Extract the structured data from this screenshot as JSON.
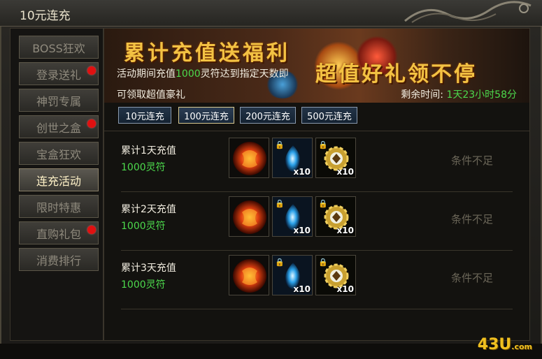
{
  "window": {
    "title": "10元连充"
  },
  "sidebar": {
    "items": [
      {
        "label": "BOSS狂欢",
        "badge": false,
        "active": false
      },
      {
        "label": "登录送礼",
        "badge": true,
        "active": false
      },
      {
        "label": "神罚专属",
        "badge": false,
        "active": false
      },
      {
        "label": "创世之盒",
        "badge": true,
        "active": false
      },
      {
        "label": "宝盒狂欢",
        "badge": false,
        "active": false
      },
      {
        "label": "连充活动",
        "badge": false,
        "active": true
      },
      {
        "label": "限时特惠",
        "badge": false,
        "active": false
      },
      {
        "label": "直购礼包",
        "badge": true,
        "active": false
      },
      {
        "label": "消费排行",
        "badge": false,
        "active": false
      }
    ]
  },
  "banner": {
    "title": "累计充值送福利",
    "slogan": "超值好礼领不停",
    "desc_prefix": "活动期间充值",
    "desc_highlight": "1000",
    "desc_suffix": "灵符达到指定天数即",
    "desc_line2": "可领取超值豪礼",
    "remain_label": "剩余时间:",
    "remain_value": "1天23小时58分"
  },
  "tabs": [
    {
      "label": "10元连充",
      "active": false
    },
    {
      "label": "100元连充",
      "active": true
    },
    {
      "label": "200元连充",
      "active": false
    },
    {
      "label": "500元连充",
      "active": false
    }
  ],
  "rows": [
    {
      "label": "累计1天充值",
      "amount": "1000灵符",
      "status": "条件不足",
      "items": [
        {
          "icon": "fire-orb-icon",
          "qty": ""
        },
        {
          "icon": "blue-flame-icon",
          "qty": "x10"
        },
        {
          "icon": "gold-gear-icon",
          "qty": "x10"
        }
      ]
    },
    {
      "label": "累计2天充值",
      "amount": "1000灵符",
      "status": "条件不足",
      "items": [
        {
          "icon": "fire-orb-icon",
          "qty": ""
        },
        {
          "icon": "blue-flame-icon",
          "qty": "x10"
        },
        {
          "icon": "gold-gear-icon",
          "qty": "x10"
        }
      ]
    },
    {
      "label": "累计3天充值",
      "amount": "1000灵符",
      "status": "条件不足",
      "items": [
        {
          "icon": "fire-orb-icon",
          "qty": ""
        },
        {
          "icon": "blue-flame-icon",
          "qty": "x10"
        },
        {
          "icon": "gold-gear-icon",
          "qty": "x10"
        }
      ]
    }
  ],
  "watermark": {
    "main": "43U",
    "suffix": ".com"
  },
  "colors": {
    "highlight_green": "#4cd94c",
    "badge_red": "#e01010",
    "gold": "#f3c243"
  }
}
